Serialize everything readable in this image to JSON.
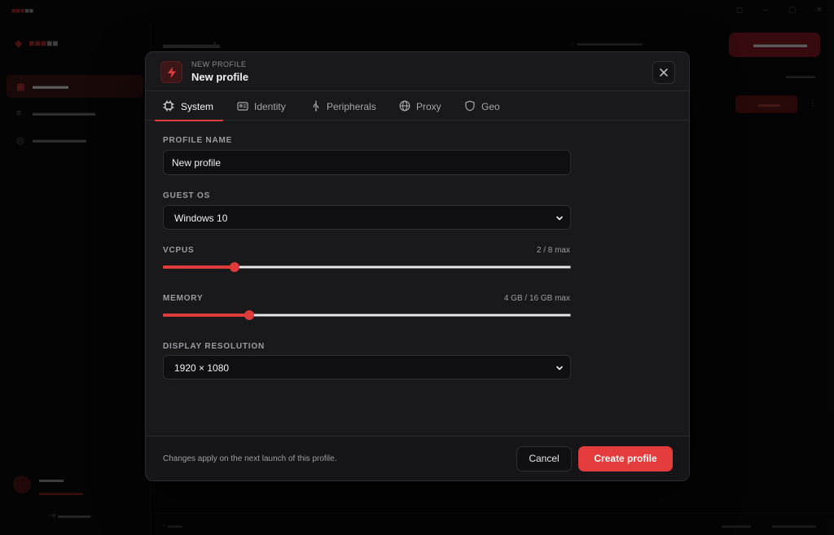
{
  "modal": {
    "eyebrow": "NEW PROFILE",
    "title": "New profile"
  },
  "tabs": [
    {
      "label": "System",
      "icon": "cpu-icon",
      "active": true
    },
    {
      "label": "Identity",
      "icon": "id-card-icon",
      "active": false
    },
    {
      "label": "Peripherals",
      "icon": "usb-icon",
      "active": false
    },
    {
      "label": "Proxy",
      "icon": "globe-icon",
      "active": false
    },
    {
      "label": "Geo",
      "icon": "shield-icon",
      "active": false
    }
  ],
  "form": {
    "profile_name": {
      "label": "PROFILE NAME",
      "value": "New profile"
    },
    "guest_os": {
      "label": "GUEST OS",
      "value": "Windows 10"
    },
    "vcpus": {
      "label": "VCPUS",
      "aux": "2 / 8 max",
      "value": 2,
      "max": 8
    },
    "memory": {
      "label": "MEMORY",
      "aux": "4 GB / 16 GB max",
      "value": 4,
      "max": 16
    },
    "display_resolution": {
      "label": "DISPLAY RESOLUTION",
      "value": "1920 × 1080"
    }
  },
  "footer": {
    "note": "Changes apply on the next launch of this profile.",
    "cancel_label": "Cancel",
    "create_label": "Create profile"
  },
  "colors": {
    "accent": "#e43c3c",
    "surface": "#19191c",
    "background": "#0b0b0d"
  }
}
